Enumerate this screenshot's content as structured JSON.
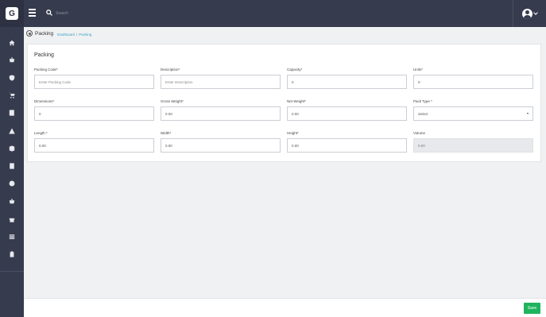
{
  "app": {
    "logo_letter": "G"
  },
  "header": {
    "search_placeholder": "Search"
  },
  "page": {
    "title": "Packing",
    "breadcrumb": {
      "home": "Dashboard",
      "separator": "/",
      "current": "Packing"
    }
  },
  "form": {
    "title": "Packing",
    "fields": {
      "packing_code": {
        "label": "Packing Code*",
        "placeholder": "Enter Packing Code",
        "value": ""
      },
      "description": {
        "label": "Description*",
        "placeholder": "Enter Description",
        "value": ""
      },
      "capacity": {
        "label": "Capacity*",
        "value": "0"
      },
      "units": {
        "label": "Units*",
        "value": "0"
      },
      "dimensions": {
        "label": "Dimensions*",
        "value": "0"
      },
      "gross_weight": {
        "label": "Gross Weight*",
        "value": "0.00"
      },
      "net_weight": {
        "label": "Net Weight*",
        "value": "0.00"
      },
      "pack_type": {
        "label": "Pack Type *",
        "selected": "Select"
      },
      "length": {
        "label": "Length *",
        "value": "0.00"
      },
      "width": {
        "label": "Width*",
        "value": "0.00"
      },
      "height": {
        "label": "Height*",
        "value": "0.00"
      },
      "volume": {
        "label": "Volume",
        "value": "0.00"
      }
    }
  },
  "footer": {
    "save_label": "Save"
  },
  "sidebar": {
    "icons": [
      "home-icon",
      "basket-icon",
      "shield-icon",
      "cart-icon",
      "book-icon",
      "warning-icon",
      "box-icon",
      "calculator-icon",
      "globe-icon",
      "basket-icon",
      "gift-icon",
      "list-icon",
      "clipboard-icon"
    ]
  },
  "colors": {
    "sidebar": "#373b4e",
    "accent": "#3aa0c8",
    "save": "#1fb45e"
  }
}
